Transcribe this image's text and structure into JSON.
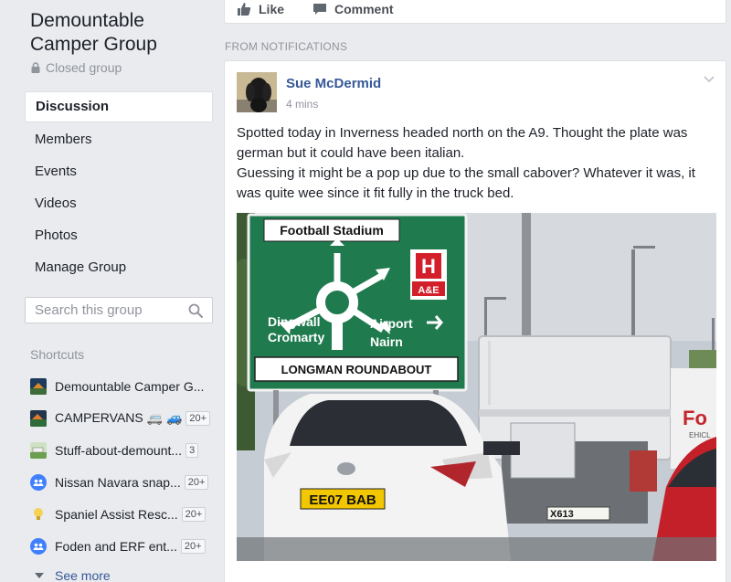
{
  "group": {
    "name": "Demountable Camper Group",
    "privacy": "Closed group"
  },
  "nav": {
    "items": [
      {
        "label": "Discussion"
      },
      {
        "label": "Members"
      },
      {
        "label": "Events"
      },
      {
        "label": "Videos"
      },
      {
        "label": "Photos"
      },
      {
        "label": "Manage Group"
      }
    ]
  },
  "search": {
    "placeholder": "Search this group"
  },
  "shortcuts": {
    "label": "Shortcuts",
    "items": [
      {
        "label": "Demountable Camper G...",
        "badge": ""
      },
      {
        "label": "CAMPERVANS 🚐 🚙",
        "badge": "20+"
      },
      {
        "label": "Stuff-about-demount...",
        "badge": "3"
      },
      {
        "label": "Nissan Navara snap...",
        "badge": "20+"
      },
      {
        "label": "Spaniel Assist Resc...",
        "badge": "20+"
      },
      {
        "label": "Foden and ERF ent...",
        "badge": "20+"
      }
    ],
    "see_more": "See more"
  },
  "previous_post": {
    "like_label": "Like",
    "comment_label": "Comment"
  },
  "section_label": "FROM NOTIFICATIONS",
  "post": {
    "author": "Sue McDermid",
    "time": "4 mins",
    "text_line1": "Spotted today in Inverness headed north on the A9. Thought the plate was german but it could have been italian.",
    "text_line2": "Guessing it might be a pop up due to the small cabover? Whatever it was, it was quite wee since it fit fully in the truck bed.",
    "photo": {
      "sign_top": "Football Stadium",
      "sign_left_1": "Dingwall",
      "sign_left_2": "Cromarty",
      "sign_right_1": "Airport",
      "sign_right_2": "Nairn",
      "sign_hospital": "H",
      "sign_ae": "A&E",
      "sign_bottom": "LONGMAN ROUNDABOUT",
      "plate": "EE07 BAB",
      "truck_plate": "X613",
      "truck_brand": "Fo",
      "truck_brand_sub": "EHICL"
    }
  },
  "colors": {
    "background": "#e9ebee",
    "link": "#365899",
    "sign_green": "#1f7a4e"
  }
}
